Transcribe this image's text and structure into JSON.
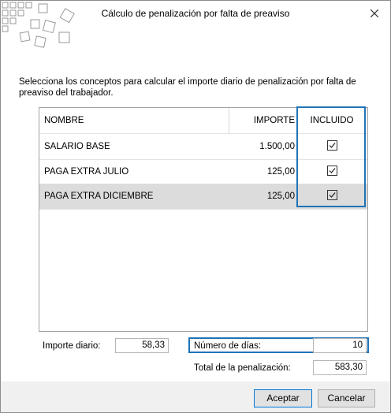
{
  "window": {
    "title": "Cálculo de penalización por falta de preaviso"
  },
  "instructions": "Selecciona los conceptos para calcular el importe diario de penalización por falta de preaviso del trabajador.",
  "table": {
    "headers": {
      "name": "NOMBRE",
      "importe": "IMPORTE",
      "incluido": "INCLUIDO"
    },
    "rows": [
      {
        "name": "SALARIO BASE",
        "importe": "1.500,00",
        "incluido": true
      },
      {
        "name": "PAGA EXTRA JULIO",
        "importe": "125,00",
        "incluido": true
      },
      {
        "name": "PAGA EXTRA DICIEMBRE",
        "importe": "125,00",
        "incluido": true
      }
    ]
  },
  "importe_diario": {
    "label": "Importe diario:",
    "value": "58,33"
  },
  "numero_dias": {
    "label": "Número de días:",
    "value": "10"
  },
  "total": {
    "label": "Total de la penalización:",
    "value": "583,30"
  },
  "buttons": {
    "accept": "Aceptar",
    "cancel": "Cancelar"
  },
  "colors": {
    "accent": "#1f73b7",
    "selected_row": "#dcdcdc",
    "footer": "#f0f0f0"
  },
  "icons": {
    "close": "close-icon",
    "logo": "squares-logo"
  }
}
